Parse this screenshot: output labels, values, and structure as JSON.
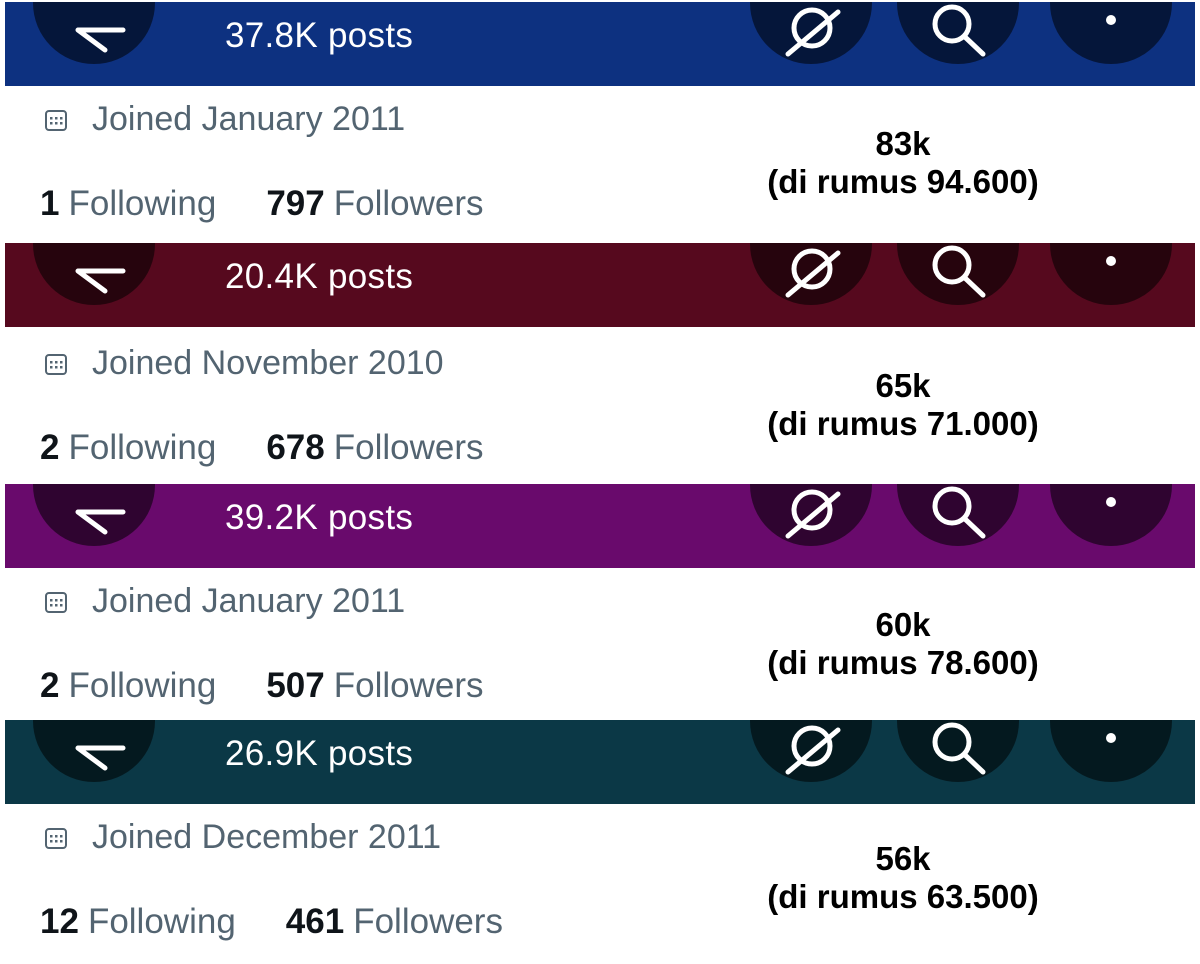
{
  "profiles": [
    {
      "header_color": "#0d3180",
      "posts_label": "37.8K posts",
      "joined": "Joined January 2011",
      "following_count": "1",
      "following_label": "Following",
      "followers_count": "797",
      "followers_label": "Followers",
      "estimate": "83k",
      "formula": "(di rumus 94.600)"
    },
    {
      "header_color": "#56091e",
      "posts_label": "20.4K posts",
      "joined": "Joined November 2010",
      "following_count": "2",
      "following_label": "Following",
      "followers_count": "678",
      "followers_label": "Followers",
      "estimate": "65k",
      "formula": "(di rumus 71.000)"
    },
    {
      "header_color": "#690a6c",
      "posts_label": "39.2K posts",
      "joined": "Joined January 2011",
      "following_count": "2",
      "following_label": "Following",
      "followers_count": "507",
      "followers_label": "Followers",
      "estimate": "60k",
      "formula": "(di rumus 78.600)"
    },
    {
      "header_color": "#0b3846",
      "posts_label": "26.9K posts",
      "joined": "Joined December 2011",
      "following_count": "12",
      "following_label": "Following",
      "followers_count": "461",
      "followers_label": "Followers",
      "estimate": "56k",
      "formula": "(di rumus 63.500)"
    }
  ],
  "icons": {
    "back": "arrow-left-icon",
    "grok": "grok-icon",
    "search": "search-icon",
    "more": "more-vertical-icon",
    "calendar": "calendar-icon"
  }
}
